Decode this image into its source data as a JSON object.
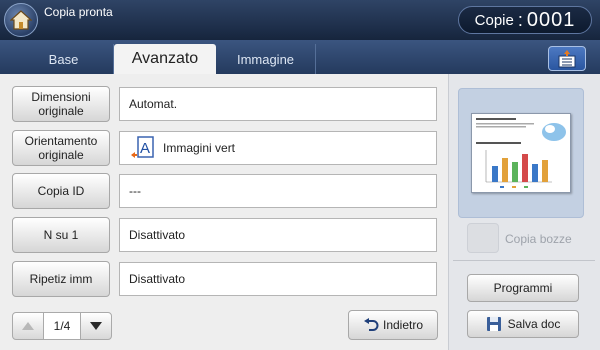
{
  "header": {
    "status": "Copia pronta",
    "copies_label": "Copie",
    "copies_separator": ":",
    "copies_value": "0001"
  },
  "tabs": [
    {
      "label": "Base",
      "active": false
    },
    {
      "label": "Avanzato",
      "active": true
    },
    {
      "label": "Immagine",
      "active": false
    }
  ],
  "rows": [
    {
      "button": "Dimensioni originale",
      "value": "Automat."
    },
    {
      "button": "Orientamento originale",
      "value": "Immagini vert",
      "icon": "portrait-orientation-icon"
    },
    {
      "button": "Copia ID",
      "value": "---"
    },
    {
      "button": "N su 1",
      "value": "Disattivato"
    },
    {
      "button": "Ripetiz imm",
      "value": "Disattivato"
    }
  ],
  "pager": {
    "current": "1/4"
  },
  "back_label": "Indietro",
  "side": {
    "proof_label": "Copia bozze",
    "programs_label": "Programmi",
    "save_label": "Salva doc"
  },
  "colors": {
    "header_bg": "#1c2c44",
    "tab_active": "#f3f3f3",
    "panel_bg": "#eeeeee",
    "accent_blue": "#2a56a0"
  }
}
